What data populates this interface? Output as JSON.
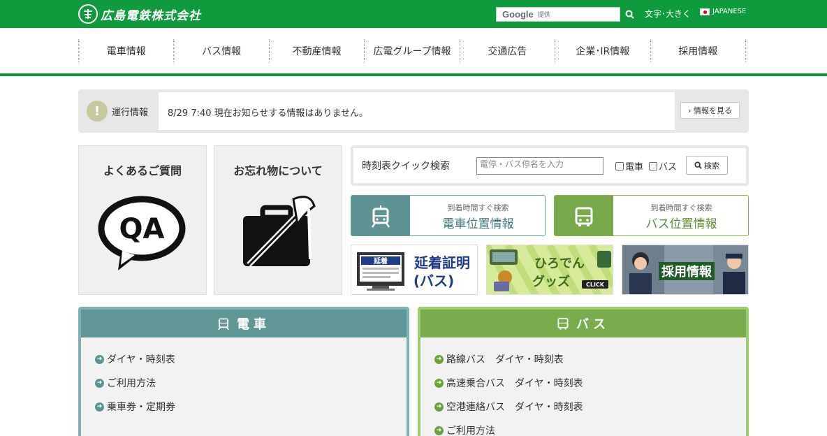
{
  "header": {
    "logo_text": "広島電鉄株式会社",
    "search": {
      "brand": "Google",
      "suffix": "提供"
    },
    "font_size_link": "文字･大きく",
    "language_link": "JAPANESE",
    "colors": {
      "brand_green": "#109a3e"
    }
  },
  "nav": {
    "items": [
      "電車情報",
      "バス情報",
      "不動産情報",
      "広電グループ情報",
      "交通広告",
      "企業･IR情報",
      "採用情報"
    ]
  },
  "service_info": {
    "label": "運行情報",
    "message": "8/29 7:40 現在お知らせする情報はありません。",
    "button": "情報を見る"
  },
  "tiles": {
    "faq": {
      "title": "よくあるご質問",
      "icon_text": "QA",
      "icon": "speech-bubble-icon"
    },
    "lost": {
      "title": "お忘れ物について",
      "icon": "bag-umbrella-icon"
    }
  },
  "timetable_search": {
    "label": "時刻表クイック検索",
    "placeholder": "電停・バス停名を入力",
    "check_train": "電車",
    "check_bus": "バス",
    "button": "検索"
  },
  "location": {
    "train": {
      "small": "到着時間すぐ検索",
      "big": "電車位置情報",
      "icon": "tram-icon"
    },
    "bus": {
      "small": "到着時間すぐ検索",
      "big": "バス位置情報",
      "icon": "bus-icon"
    }
  },
  "banners": {
    "proof": {
      "badge": "延着",
      "title_top": "延着証明",
      "title_bottom": "(バス)"
    },
    "goods": {
      "title_top": "ひろでん",
      "title_bottom": "グッズ",
      "click": "CLICK"
    },
    "recruit": {
      "title": "採用情報"
    }
  },
  "sections": {
    "train": {
      "title": "電車",
      "links": [
        "ダイヤ・時刻表",
        "ご利用方法",
        "乗車券・定期券"
      ]
    },
    "bus": {
      "title": "バス",
      "links": [
        "路線バス　ダイヤ・時刻表",
        "高速乗合バス　ダイヤ・時刻表",
        "空港連絡バス　ダイヤ・時刻表",
        "ご利用方法"
      ]
    }
  }
}
